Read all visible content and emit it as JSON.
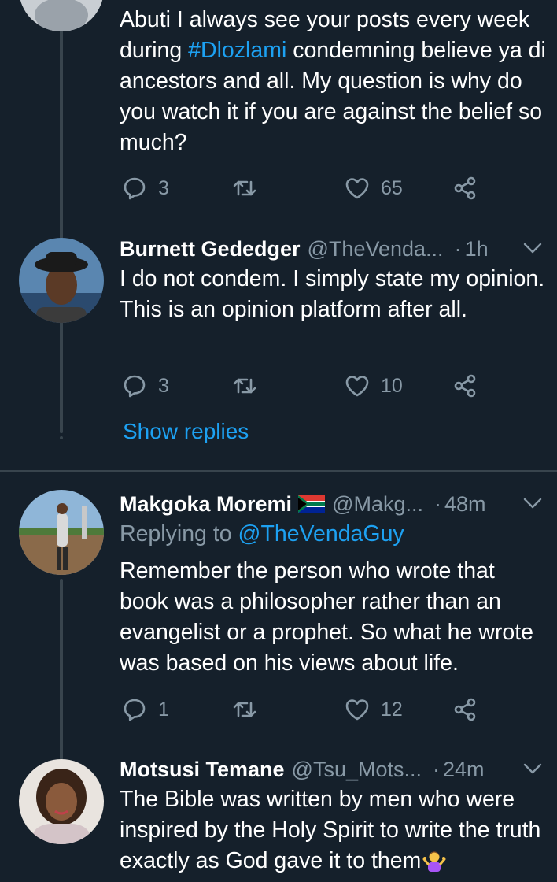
{
  "colors": {
    "background": "#15202b",
    "accent": "#1da1f2",
    "muted": "#8899a6",
    "line": "#38444d"
  },
  "tweets": [
    {
      "text_before": "Abuti I always see your posts every week during ",
      "hashtag": "#Dlozlami",
      "text_after": " condemning believe ya di ancestors and all. My question is why do you watch it if you are against the belief so much?",
      "counts": {
        "replies": "3",
        "retweets": "",
        "likes": "65"
      }
    },
    {
      "name": "Burnett Gededger",
      "handle": "@TheVenda...",
      "separator": "·",
      "time": "1h",
      "text": "I do not condem. I simply state my opinion. This is an opinion platform after all.",
      "counts": {
        "replies": "3",
        "retweets": "",
        "likes": "10"
      },
      "show_replies": "Show replies"
    },
    {
      "name": "Makgoka Moremi",
      "flag_icon": "south-africa-flag-icon",
      "handle": "@Makg...",
      "separator": "·",
      "time": "48m",
      "replying_prefix": "Replying to ",
      "replying_to": "@TheVendaGuy",
      "text": "Remember the person who wrote that book was a philosopher rather than an evangelist or a prophet. So what he wrote was based on his views about life.",
      "counts": {
        "replies": "1",
        "retweets": "",
        "likes": "12"
      }
    },
    {
      "name": "Motsusi Temane",
      "handle": "@Tsu_Mots...",
      "separator": "·",
      "time": "24m",
      "text": "The Bible was written by men who were inspired by the Holy Spirit to write the truth exactly as God gave it to them",
      "emoji_icon": "person-shrugging-emoji-icon"
    }
  ]
}
